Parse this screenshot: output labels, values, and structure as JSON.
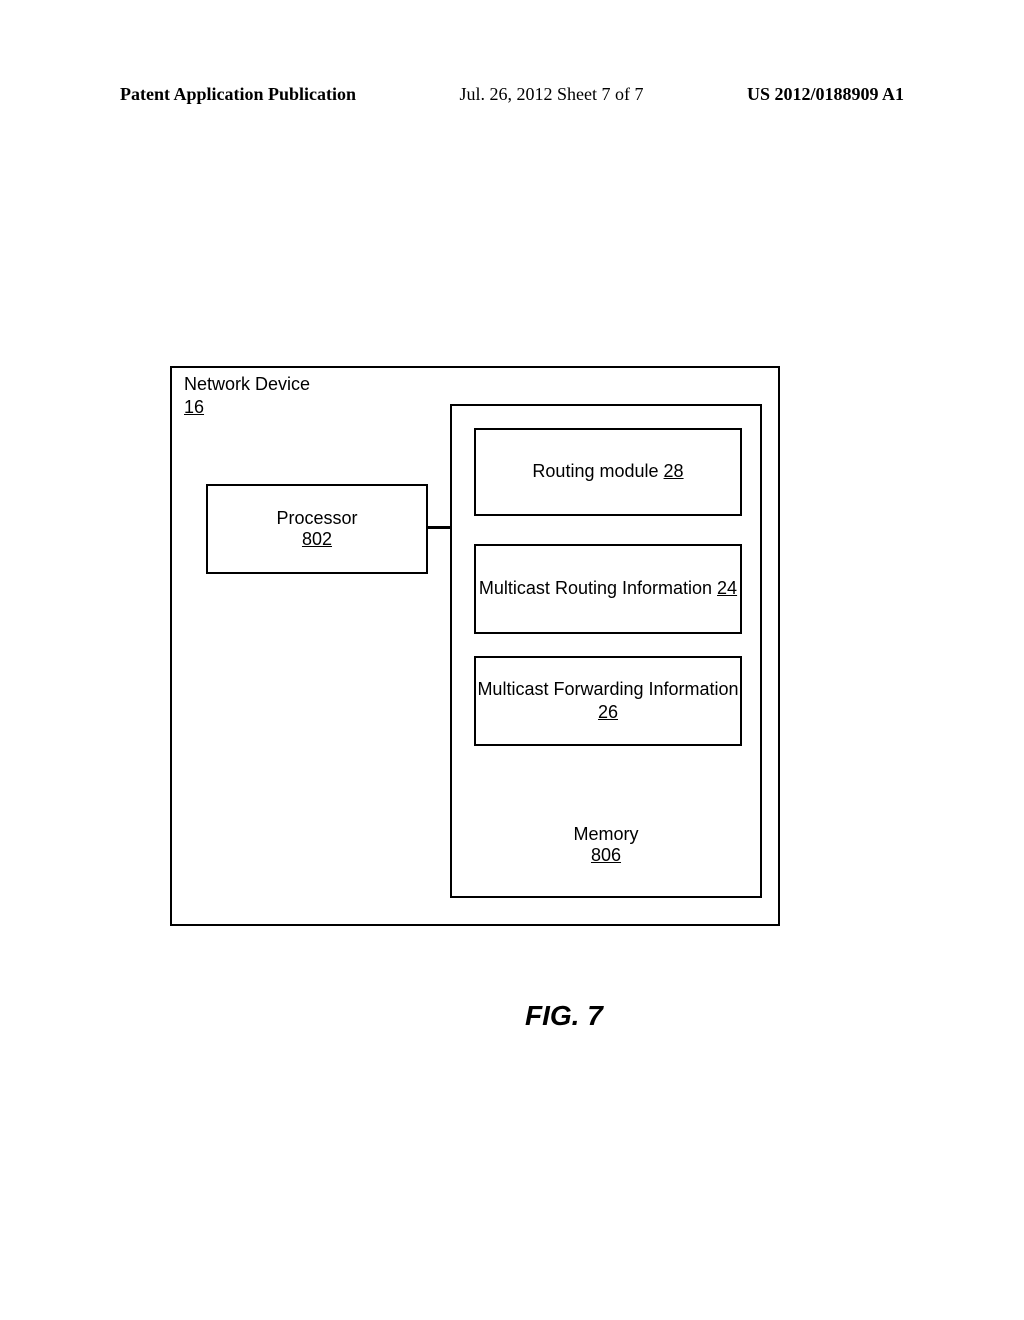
{
  "header": {
    "left": "Patent Application Publication",
    "center": "Jul. 26, 2012  Sheet 7 of 7",
    "right": "US 2012/0188909 A1"
  },
  "diagram": {
    "device_label": "Network Device",
    "device_ref": "16",
    "processor_label": "Processor",
    "processor_ref": "802",
    "routing_module_label": "Routing module",
    "routing_module_ref": "28",
    "multicast_routing_label": "Multicast Routing Information",
    "multicast_routing_ref": "24",
    "multicast_forwarding_label": "Multicast Forwarding Information",
    "multicast_forwarding_ref": "26",
    "memory_label": "Memory",
    "memory_ref": "806"
  },
  "figure_caption": "FIG. 7"
}
